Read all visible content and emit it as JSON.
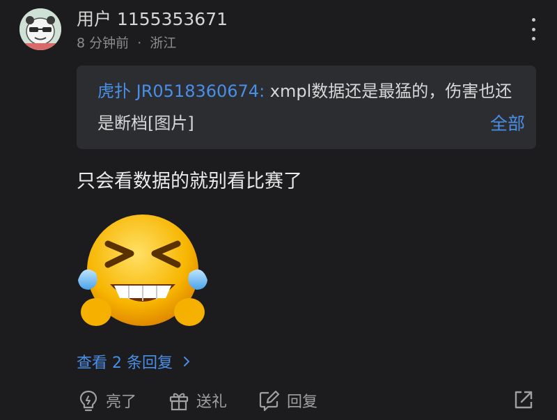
{
  "comment": {
    "username": "用户 1155353671",
    "time": "8 分钟前",
    "separator": "·",
    "location": "浙江",
    "avatar_icon": "panda-meme-avatar",
    "quote": {
      "author": "虎扑 JR0518360674:",
      "text": " xmpl数据还是最猛的，伤害也还是断档[图片]",
      "expand_label": "全部"
    },
    "body": "只会看数据的就别看比赛了",
    "sticker_icon": "laughing-tears-emoji",
    "view_replies": "查看 2 条回复"
  },
  "actions": {
    "like": {
      "label": "亮了",
      "icon": "lightbulb-icon"
    },
    "gift": {
      "label": "送礼",
      "icon": "gift-icon"
    },
    "reply": {
      "label": "回复",
      "icon": "reply-edit-icon"
    },
    "share_icon": "share-icon"
  },
  "colors": {
    "background": "#1c1c1e",
    "accent": "#4a8fe7",
    "quote_bg": "#2b2d30"
  }
}
